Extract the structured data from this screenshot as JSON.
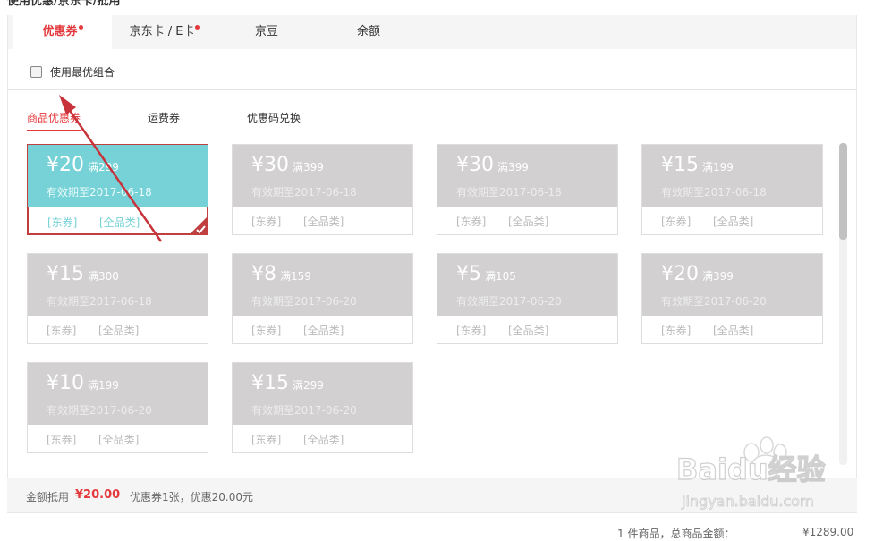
{
  "header": {
    "title": "使用优惠/京东卡/抵用"
  },
  "tabs": [
    {
      "label": "优惠券",
      "active": true,
      "dot": true
    },
    {
      "label": "京东卡 / E卡",
      "active": false,
      "dot": true
    },
    {
      "label": "京豆",
      "active": false,
      "dot": false
    },
    {
      "label": "余额",
      "active": false,
      "dot": false
    }
  ],
  "best_combo": {
    "label": "使用最优组合",
    "checked": false
  },
  "subtabs": [
    {
      "label": "商品优惠券",
      "active": true
    },
    {
      "label": "运费券",
      "active": false
    },
    {
      "label": "优惠码兑换",
      "active": false
    }
  ],
  "coupons": [
    {
      "amount": "¥20",
      "condition": "满299",
      "valid": "有效期至2017-06-18",
      "tag1": "[东券]",
      "tag2": "[全品类]",
      "selected": true
    },
    {
      "amount": "¥30",
      "condition": "满399",
      "valid": "有效期至2017-06-18",
      "tag1": "[东券]",
      "tag2": "[全品类]",
      "selected": false
    },
    {
      "amount": "¥30",
      "condition": "满399",
      "valid": "有效期至2017-06-18",
      "tag1": "[东券]",
      "tag2": "[全品类]",
      "selected": false
    },
    {
      "amount": "¥15",
      "condition": "满199",
      "valid": "有效期至2017-06-18",
      "tag1": "[东券]",
      "tag2": "[全品类]",
      "selected": false
    },
    {
      "amount": "¥15",
      "condition": "满300",
      "valid": "有效期至2017-06-18",
      "tag1": "[东券]",
      "tag2": "[全品类]",
      "selected": false
    },
    {
      "amount": "¥8",
      "condition": "满159",
      "valid": "有效期至2017-06-20",
      "tag1": "[东券]",
      "tag2": "[全品类]",
      "selected": false
    },
    {
      "amount": "¥5",
      "condition": "满105",
      "valid": "有效期至2017-06-20",
      "tag1": "[东券]",
      "tag2": "[全品类]",
      "selected": false
    },
    {
      "amount": "¥20",
      "condition": "满399",
      "valid": "有效期至2017-06-20",
      "tag1": "[东券]",
      "tag2": "[全品类]",
      "selected": false
    },
    {
      "amount": "¥10",
      "condition": "满199",
      "valid": "有效期至2017-06-20",
      "tag1": "[东券]",
      "tag2": "[全品类]",
      "selected": false
    },
    {
      "amount": "¥15",
      "condition": "满299",
      "valid": "有效期至2017-06-20",
      "tag1": "[东券]",
      "tag2": "[全品类]",
      "selected": false
    }
  ],
  "footer": {
    "label": "金额抵用",
    "value": "¥20.00",
    "detail": "优惠券1张，优惠20.00元"
  },
  "summary": {
    "text": "1 件商品，总商品金额：",
    "price": "¥1289.00"
  },
  "watermark": {
    "brand": "Baidu经验",
    "url": "jingyan.baidu.com"
  },
  "colors": {
    "accent": "#e4393c",
    "selected_coupon": "#76d2d6",
    "coupon_gray": "#d2d0d1",
    "arrow": "#c8323a"
  }
}
